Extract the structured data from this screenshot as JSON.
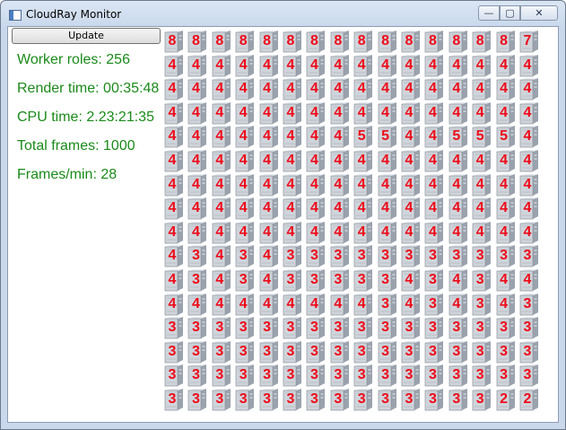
{
  "window": {
    "title": "CloudRay Monitor",
    "icon": "app-window-icon",
    "controls": {
      "minimize": "—",
      "maximize": "▢",
      "close": "✕"
    }
  },
  "toolbar": {
    "update_label": "Update"
  },
  "stats": [
    {
      "label": "Worker roles: 256"
    },
    {
      "label": "Render time: 00:35:48"
    },
    {
      "label": "CPU time: 2.23:21:35"
    },
    {
      "label": "Total frames: 1000"
    },
    {
      "label": "Frames/min: 28"
    }
  ],
  "colors": {
    "stat_text": "#1a8a1a",
    "cell_number": "#ee0a18",
    "server_body": "#c9ced6"
  },
  "grid": {
    "icon": "server-icon",
    "rows": [
      [
        "8",
        "8",
        "8",
        "8",
        "8",
        "8",
        "8",
        "8",
        "8",
        "8",
        "8",
        "8",
        "8",
        "8",
        "8",
        "7"
      ],
      [
        "4",
        "4",
        "4",
        "4",
        "4",
        "4",
        "4",
        "4",
        "4",
        "4",
        "4",
        "4",
        "4",
        "4",
        "4",
        "4"
      ],
      [
        "4",
        "4",
        "4",
        "4",
        "4",
        "4",
        "4",
        "4",
        "4",
        "4",
        "4",
        "4",
        "4",
        "4",
        "4",
        "4"
      ],
      [
        "4",
        "4",
        "4",
        "4",
        "4",
        "4",
        "4",
        "4",
        "4",
        "4",
        "4",
        "4",
        "4",
        "4",
        "4",
        "4"
      ],
      [
        "4",
        "4",
        "4",
        "4",
        "4",
        "4",
        "4",
        "4",
        "5",
        "5",
        "4",
        "4",
        "5",
        "5",
        "5",
        "4"
      ],
      [
        "4",
        "4",
        "4",
        "4",
        "4",
        "4",
        "4",
        "4",
        "4",
        "4",
        "4",
        "4",
        "4",
        "4",
        "4",
        "4"
      ],
      [
        "4",
        "4",
        "4",
        "4",
        "4",
        "4",
        "4",
        "4",
        "4",
        "4",
        "4",
        "4",
        "4",
        "4",
        "4",
        "4"
      ],
      [
        "4",
        "4",
        "4",
        "4",
        "4",
        "4",
        "4",
        "4",
        "4",
        "4",
        "4",
        "4",
        "4",
        "4",
        "4",
        "4"
      ],
      [
        "4",
        "4",
        "4",
        "4",
        "4",
        "4",
        "4",
        "4",
        "4",
        "4",
        "4",
        "4",
        "4",
        "4",
        "4",
        "4"
      ],
      [
        "4",
        "3",
        "4",
        "3",
        "4",
        "3",
        "3",
        "3",
        "3",
        "3",
        "3",
        "3",
        "3",
        "3",
        "3",
        "3"
      ],
      [
        "4",
        "3",
        "4",
        "3",
        "4",
        "3",
        "3",
        "3",
        "3",
        "3",
        "4",
        "3",
        "4",
        "3",
        "4",
        "4"
      ],
      [
        "4",
        "4",
        "4",
        "4",
        "4",
        "4",
        "4",
        "4",
        "4",
        "3",
        "4",
        "3",
        "4",
        "3",
        "4",
        "3"
      ],
      [
        "3",
        "3",
        "3",
        "3",
        "3",
        "3",
        "3",
        "3",
        "3",
        "3",
        "3",
        "3",
        "3",
        "3",
        "3",
        "3"
      ],
      [
        "3",
        "3",
        "3",
        "3",
        "3",
        "3",
        "3",
        "3",
        "3",
        "3",
        "3",
        "3",
        "3",
        "3",
        "3",
        "3"
      ],
      [
        "3",
        "3",
        "3",
        "3",
        "3",
        "3",
        "3",
        "3",
        "3",
        "3",
        "3",
        "3",
        "3",
        "3",
        "3",
        "3"
      ],
      [
        "3",
        "3",
        "3",
        "3",
        "3",
        "3",
        "3",
        "3",
        "3",
        "3",
        "3",
        "3",
        "3",
        "3",
        "2",
        "2"
      ]
    ]
  }
}
